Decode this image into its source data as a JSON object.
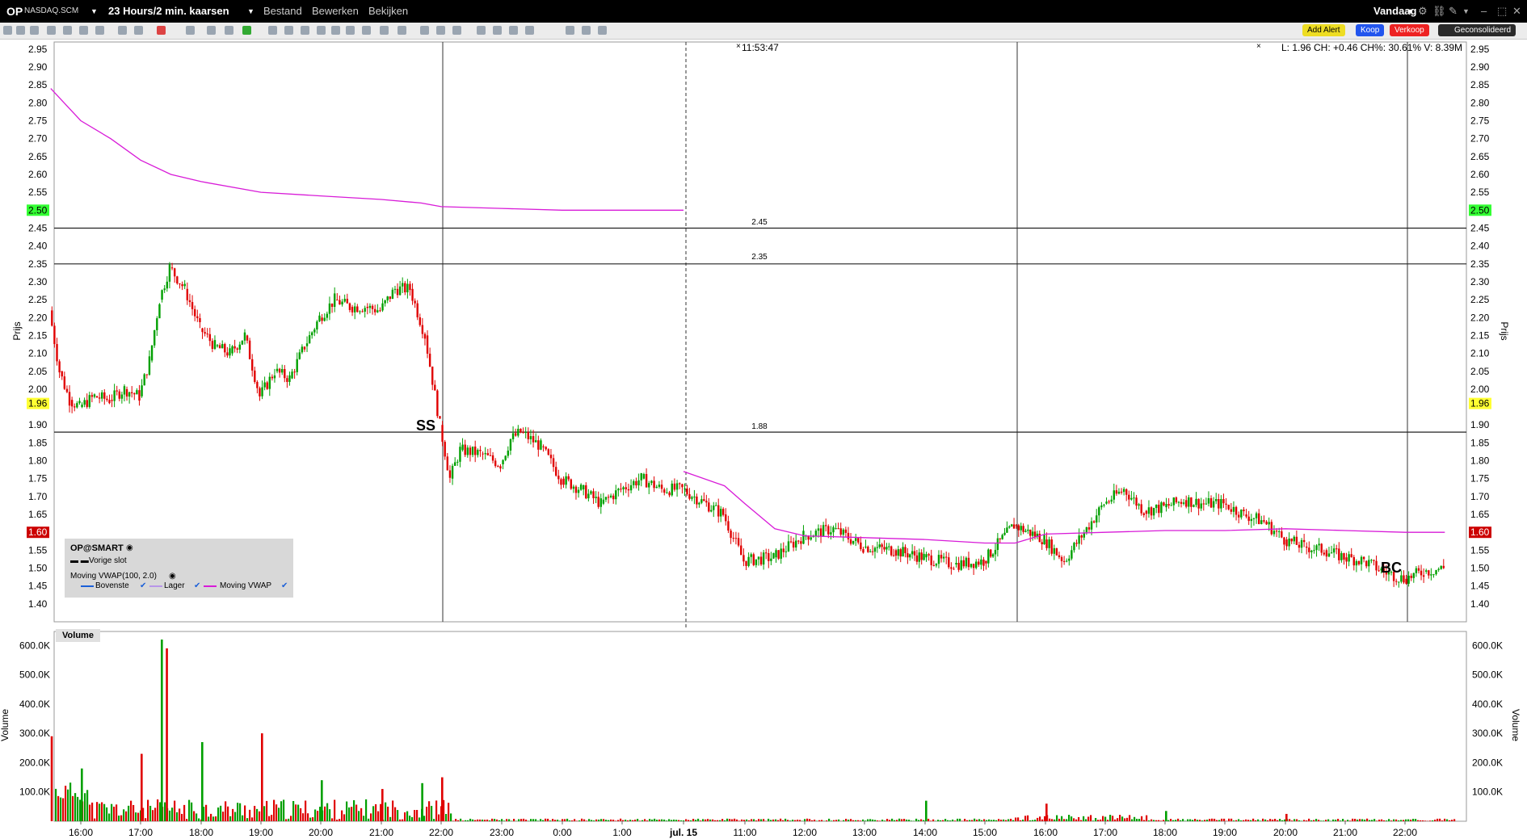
{
  "titlebar": {
    "symbol": "OP",
    "exchange": "NASDAQ.SCM",
    "timeframe": "23 Hours/2 min. kaarsen",
    "menu": [
      "Bestand",
      "Bewerken",
      "Bekijken"
    ],
    "period": "Vandaag"
  },
  "toolbar": {
    "add_alert": "Add Alert",
    "buy": "Koop",
    "sell": "Verkoop",
    "consolidated": "Geconsolideerd"
  },
  "colors": {
    "up_candle": "#00a000",
    "down_candle": "#e00000",
    "vwap": "#d81bd8",
    "current_price_highlight": "#ffff33",
    "level_highlight": "#33ff33",
    "vwap_level_highlight": "#cc0000",
    "buy_button": "#2255ee",
    "sell_button": "#ee2222",
    "alert_button": "#eedd22"
  },
  "chart": {
    "cursor_time": "11:53:47",
    "readout": "L: 1.96 CH: +0.46 CH%: 30.61% V: 8.39M",
    "y_axis_label": "Prijs",
    "current_price": "1.96",
    "vwap_level": "1.60",
    "highlight_level": "2.50",
    "hline_labels": [
      "2.45",
      "2.35",
      "1.88"
    ],
    "markers": [
      "SS",
      "BC"
    ],
    "volume_panel_label": "Volume",
    "volume_axis_label": "Volume",
    "volume_ticks": [
      "600.0K",
      "500.0K",
      "400.0K",
      "300.0K",
      "200.0K",
      "100.0K"
    ],
    "x_ticks": [
      "16:00",
      "17:00",
      "18:00",
      "19:00",
      "20:00",
      "21:00",
      "22:00",
      "23:00",
      "0:00",
      "1:00",
      "jul. 15",
      "11:00",
      "12:00",
      "13:00",
      "14:00",
      "15:00",
      "16:00",
      "17:00",
      "18:00",
      "19:00",
      "20:00",
      "21:00",
      "22:00"
    ]
  },
  "legend": {
    "title": "OP@SMART",
    "prev_close": "Vorige slot",
    "indicator": "Moving VWAP(100, 2.0)",
    "items": [
      "Bovenste",
      "Lager",
      "Moving VWAP"
    ]
  },
  "chart_data": {
    "type": "candlestick",
    "y_label": "Prijs",
    "ylim": [
      1.35,
      2.97
    ],
    "y_ticks": [
      2.95,
      2.9,
      2.85,
      2.8,
      2.75,
      2.7,
      2.65,
      2.6,
      2.55,
      2.5,
      2.45,
      2.4,
      2.35,
      2.3,
      2.25,
      2.2,
      2.15,
      2.1,
      2.05,
      2.0,
      1.96,
      1.9,
      1.85,
      1.8,
      1.75,
      1.7,
      1.65,
      1.6,
      1.55,
      1.5,
      1.45,
      1.4
    ],
    "horizontal_lines": [
      2.45,
      2.35,
      1.88
    ],
    "price_path": [
      [
        "15:30",
        2.22
      ],
      [
        "15:40",
        2.05
      ],
      [
        "15:50",
        1.97
      ],
      [
        "16:00",
        1.95
      ],
      [
        "16:15",
        1.98
      ],
      [
        "16:30",
        1.97
      ],
      [
        "16:45",
        2.0
      ],
      [
        "17:00",
        1.98
      ],
      [
        "17:10",
        2.08
      ],
      [
        "17:20",
        2.25
      ],
      [
        "17:30",
        2.34
      ],
      [
        "17:45",
        2.28
      ],
      [
        "18:00",
        2.17
      ],
      [
        "18:15",
        2.12
      ],
      [
        "18:30",
        2.1
      ],
      [
        "18:45",
        2.15
      ],
      [
        "19:00",
        1.98
      ],
      [
        "19:15",
        2.05
      ],
      [
        "19:30",
        2.03
      ],
      [
        "19:45",
        2.12
      ],
      [
        "20:00",
        2.2
      ],
      [
        "20:15",
        2.25
      ],
      [
        "20:30",
        2.23
      ],
      [
        "20:45",
        2.23
      ],
      [
        "21:00",
        2.22
      ],
      [
        "21:15",
        2.28
      ],
      [
        "21:30",
        2.28
      ],
      [
        "21:45",
        2.15
      ],
      [
        "22:00",
        1.9
      ],
      [
        "22:10",
        1.75
      ],
      [
        "22:20",
        1.83
      ],
      [
        "22:40",
        1.82
      ],
      [
        "23:00",
        1.79
      ],
      [
        "23:10",
        1.86
      ],
      [
        "23:20",
        1.88
      ],
      [
        "23:40",
        1.84
      ],
      [
        "0:00",
        1.75
      ],
      [
        "0:20",
        1.72
      ],
      [
        "0:40",
        1.68
      ],
      [
        "1:00",
        1.72
      ],
      [
        "1:20",
        1.75
      ],
      [
        "1:40",
        1.72
      ],
      [
        "jul. 15",
        1.72
      ],
      [
        "10:40",
        1.65
      ],
      [
        "11:00",
        1.52
      ],
      [
        "11:30",
        1.53
      ],
      [
        "12:00",
        1.59
      ],
      [
        "12:30",
        1.61
      ],
      [
        "13:00",
        1.56
      ],
      [
        "13:30",
        1.55
      ],
      [
        "14:00",
        1.53
      ],
      [
        "14:30",
        1.51
      ],
      [
        "15:00",
        1.52
      ],
      [
        "15:30",
        1.62
      ],
      [
        "16:00",
        1.58
      ],
      [
        "16:20",
        1.52
      ],
      [
        "16:40",
        1.6
      ],
      [
        "17:00",
        1.68
      ],
      [
        "17:20",
        1.72
      ],
      [
        "17:40",
        1.66
      ],
      [
        "18:00",
        1.67
      ],
      [
        "18:20",
        1.69
      ],
      [
        "18:40",
        1.68
      ],
      [
        "19:00",
        1.68
      ],
      [
        "19:20",
        1.65
      ],
      [
        "19:40",
        1.63
      ],
      [
        "20:00",
        1.58
      ],
      [
        "20:20",
        1.56
      ],
      [
        "20:40",
        1.55
      ],
      [
        "21:00",
        1.53
      ],
      [
        "21:20",
        1.52
      ],
      [
        "21:40",
        1.49
      ],
      [
        "22:00",
        1.47
      ],
      [
        "22:20",
        1.49
      ],
      [
        "22:40",
        1.5
      ]
    ],
    "vwap_path": [
      [
        "15:30",
        2.84
      ],
      [
        "16:00",
        2.75
      ],
      [
        "16:30",
        2.7
      ],
      [
        "17:00",
        2.64
      ],
      [
        "17:30",
        2.6
      ],
      [
        "18:00",
        2.58
      ],
      [
        "19:00",
        2.55
      ],
      [
        "20:00",
        2.54
      ],
      [
        "21:00",
        2.53
      ],
      [
        "21:40",
        2.52
      ],
      [
        "22:00",
        2.51
      ],
      [
        "23:00",
        2.505
      ],
      [
        "0:00",
        2.5
      ],
      [
        "1:00",
        2.5
      ],
      [
        "jul. 15",
        2.5
      ]
    ],
    "vwap_path_day2": [
      [
        "jul. 15",
        1.77
      ],
      [
        "10:40",
        1.73
      ],
      [
        "11:00",
        1.68
      ],
      [
        "11:30",
        1.61
      ],
      [
        "12:00",
        1.59
      ],
      [
        "13:00",
        1.585
      ],
      [
        "14:00",
        1.58
      ],
      [
        "15:00",
        1.57
      ],
      [
        "15:30",
        1.57
      ],
      [
        "16:00",
        1.595
      ],
      [
        "17:00",
        1.6
      ],
      [
        "18:00",
        1.605
      ],
      [
        "19:00",
        1.605
      ],
      [
        "20:00",
        1.61
      ],
      [
        "21:00",
        1.605
      ],
      [
        "22:00",
        1.6
      ],
      [
        "22:40",
        1.6
      ]
    ],
    "volume_ylim": [
      0,
      620
    ],
    "volume_unit": "K",
    "volume_spikes": [
      [
        "15:30",
        290
      ],
      [
        "16:00",
        180
      ],
      [
        "17:00",
        230
      ],
      [
        "17:20",
        620
      ],
      [
        "17:25",
        590
      ],
      [
        "18:00",
        270
      ],
      [
        "19:00",
        300
      ],
      [
        "20:00",
        140
      ],
      [
        "21:00",
        110
      ],
      [
        "21:40",
        130
      ],
      [
        "22:00",
        150
      ],
      [
        "14:00",
        70
      ],
      [
        "16:00",
        60
      ],
      [
        "18:00",
        35
      ],
      [
        "20:00",
        25
      ]
    ]
  }
}
